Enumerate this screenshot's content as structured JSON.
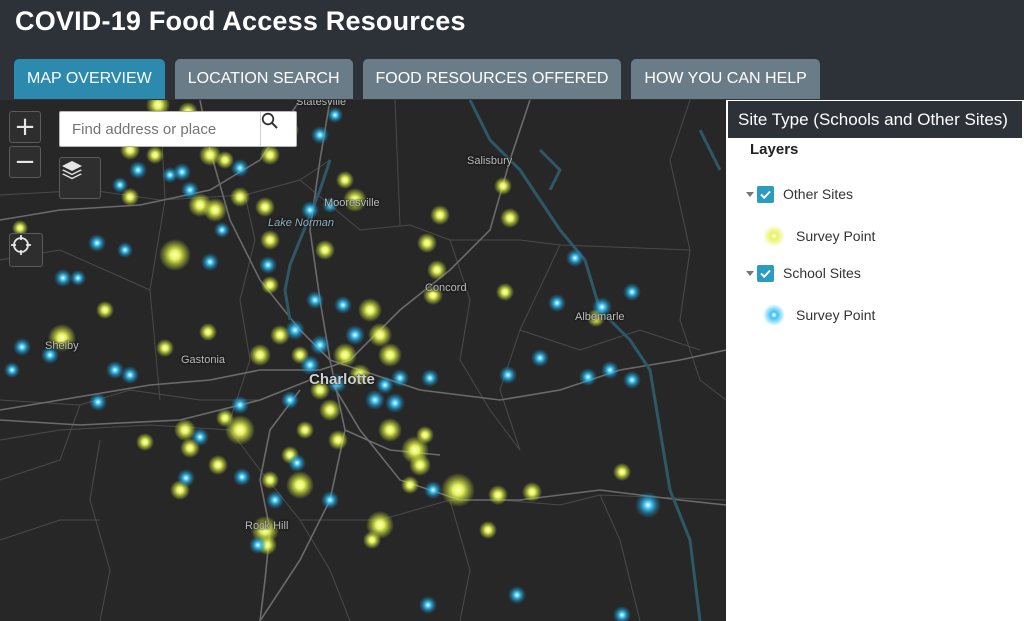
{
  "app": {
    "title": "COVID-19 Food Access Resources"
  },
  "tabs": [
    {
      "label": "MAP OVERVIEW",
      "active": true
    },
    {
      "label": "LOCATION SEARCH",
      "active": false
    },
    {
      "label": "FOOD RESOURCES OFFERED",
      "active": false
    },
    {
      "label": "HOW YOU CAN HELP",
      "active": false
    }
  ],
  "map": {
    "zoom_in": "+",
    "zoom_out": "−",
    "search_placeholder": "Find address or place",
    "layers_icon": "layers-icon",
    "locate_icon": "locate-icon",
    "search_icon": "search-icon",
    "places": {
      "statesville": "Statesville",
      "salisbury": "Salisbury",
      "mooresville": "Mooresville",
      "lake_norman": "Lake Norman",
      "concord": "Concord",
      "albemarle": "Albemarle",
      "shelby": "Shelby",
      "gastonia": "Gastonia",
      "charlotte": "Charlotte",
      "rock_hill": "Rock Hill"
    },
    "colors": {
      "other_sites": "#e8f56a",
      "school_sites": "#2fb8f0",
      "basemap": "#272727"
    }
  },
  "legend": {
    "header": "Site Type (Schools and Other Sites)",
    "title": "Layers",
    "groups": [
      {
        "label": "Other Sites",
        "checked": true,
        "item": "Survey Point"
      },
      {
        "label": "School Sites",
        "checked": true,
        "item": "Survey Point"
      }
    ]
  }
}
